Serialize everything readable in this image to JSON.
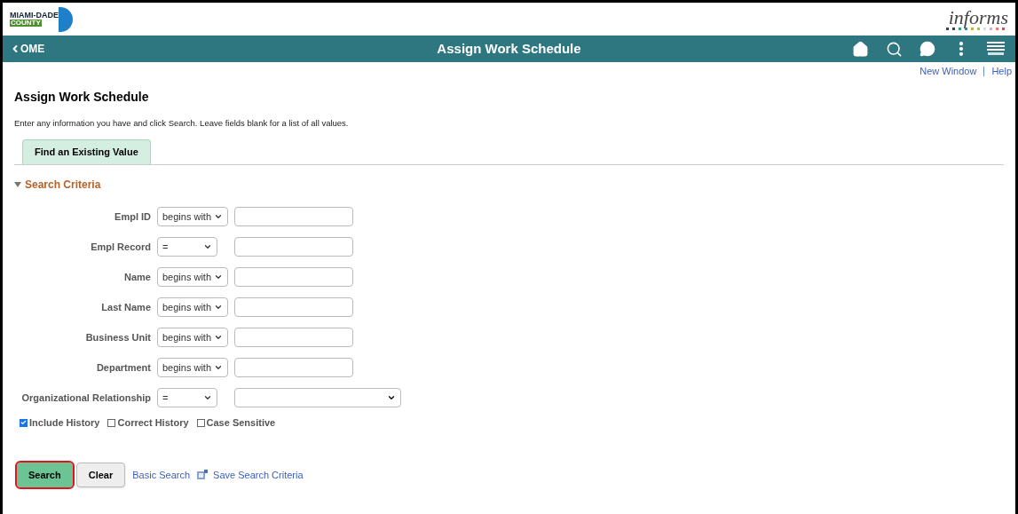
{
  "header": {
    "logo_top": "MIAMI-DADE",
    "logo_bottom": "COUNTY",
    "brand": "informs"
  },
  "navbar": {
    "back": "OME",
    "title": "Assign Work Schedule"
  },
  "links": [
    "New Window",
    "Help"
  ],
  "page": {
    "title": "Assign Work Schedule",
    "instructions": "Enter any information you have and click Search. Leave fields blank for a list of all values."
  },
  "tabs": [
    {
      "label": "Find an Existing Value",
      "selected": true
    }
  ],
  "section": {
    "title": "Search Criteria",
    "expanded": true
  },
  "fields": [
    {
      "label": "Empl ID",
      "operator": "begins with",
      "kind": "text"
    },
    {
      "label": "Empl Record",
      "operator": "=",
      "kind": "text"
    },
    {
      "label": "Name",
      "operator": "begins with",
      "kind": "text"
    },
    {
      "label": "Last Name",
      "operator": "begins with",
      "kind": "text"
    },
    {
      "label": "Business Unit",
      "operator": "begins with",
      "kind": "text"
    },
    {
      "label": "Department",
      "operator": "begins with",
      "kind": "text"
    },
    {
      "label": "Organizational Relationship",
      "operator": "=",
      "kind": "select"
    }
  ],
  "options": [
    {
      "label": "Include History",
      "checked": true
    },
    {
      "label": "Correct History",
      "checked": false
    },
    {
      "label": "Case Sensitive",
      "checked": false
    }
  ],
  "buttons": [
    {
      "label": "Search",
      "primary": true,
      "highlighted": true
    },
    {
      "label": "Clear",
      "primary": false,
      "highlighted": false
    }
  ],
  "footer_links": [
    {
      "label": "Basic Search",
      "icon": false
    },
    {
      "label": "Save Search Criteria",
      "icon": true
    }
  ]
}
